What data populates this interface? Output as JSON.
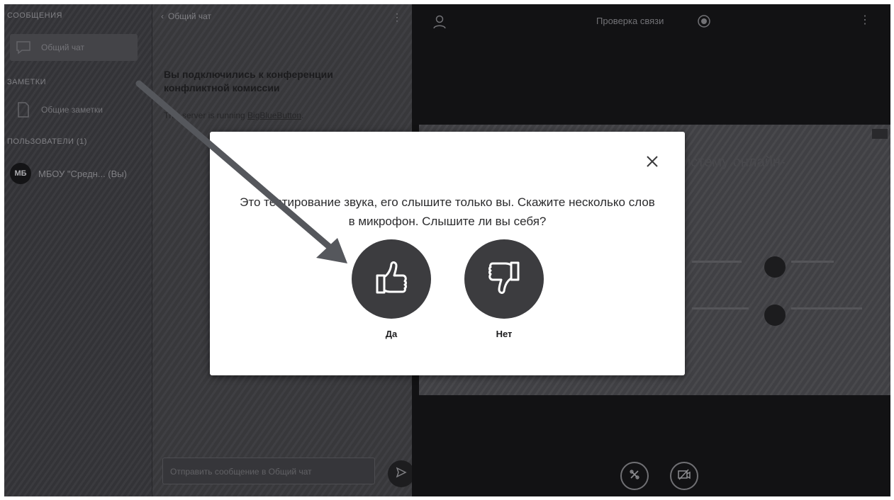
{
  "sidebar": {
    "messages_title": "СООБЩЕНИЯ",
    "public_chat_label": "Общий чат",
    "notes_title": "ЗАМЕТКИ",
    "shared_notes_label": "Общие заметки",
    "users_title": "ПОЛЬЗОВАТЕЛИ (1)",
    "user": {
      "initials": "МБ",
      "name": "МБОУ \"Средн... (Вы)"
    }
  },
  "chat": {
    "header_title": "Общий чат",
    "back_icon": "chevron-left-icon",
    "welcome_text": "Вы подключились к конференции конфликтной комиссии",
    "server_prefix": "This server is running ",
    "server_link": "BigBlueButton",
    "server_suffix": ".",
    "input_placeholder": "Отправить сообщение в Общий чат",
    "send_icon": "send-icon"
  },
  "main": {
    "room_title": "Проверка связи",
    "user_icon": "user-icon",
    "record_icon": "record-icon",
    "presentation_heading": "истему онлайн-",
    "controls": [
      "mute-microphone-icon",
      "camera-off-icon"
    ]
  },
  "modal": {
    "prompt": "Это тестирование звука, его слышите только вы. Скажите несколько слов в микрофон. Слышите ли вы себя?",
    "yes_label": "Да",
    "no_label": "Нет",
    "yes_icon": "thumbs-up-icon",
    "no_icon": "thumbs-down-icon",
    "close_icon": "close-icon"
  },
  "colors": {
    "dark_panel": "#3a3a3e",
    "main_bg": "#141416",
    "modal_bg": "#ffffff",
    "button_circle": "#3c3c3f",
    "annotation_arrow": "#55575c"
  }
}
